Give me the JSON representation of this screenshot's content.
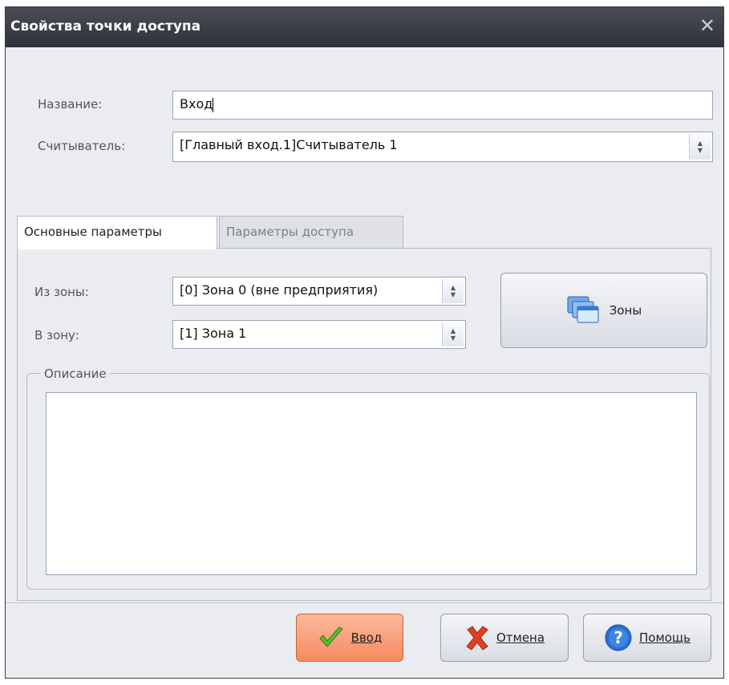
{
  "window": {
    "title": "Свойства точки доступа"
  },
  "form": {
    "name_label": "Название:",
    "name_value": "Вход",
    "reader_label": "Считыватель:",
    "reader_value": "[Главный вход.1]Считыватель 1"
  },
  "tabs": [
    {
      "label": "Основные параметры",
      "active": true
    },
    {
      "label": "Параметры доступа",
      "active": false
    }
  ],
  "main_tab": {
    "from_zone_label": "Из зоны:",
    "from_zone_value": "[0] Зона 0 (вне предприятия)",
    "to_zone_label": "В зону:",
    "to_zone_value": "[1] Зона 1",
    "zones_button_label": "Зоны",
    "description_title": "Описание",
    "description_value": ""
  },
  "buttons": {
    "ok_label": "Ввод",
    "cancel_label": "Отмена",
    "help_label": "Помощь"
  },
  "icons": {
    "close": "close-icon",
    "spin": "spin-updown-icon",
    "zones": "windows-stack-icon",
    "ok": "green-check-icon",
    "cancel": "red-x-icon",
    "help": "question-circle-icon"
  },
  "colors": {
    "titlebar": "#3a3d45",
    "ok_button": "#f68a5f",
    "check": "#5dbb2f",
    "cross": "#e04020",
    "help": "#2a6fd0"
  }
}
